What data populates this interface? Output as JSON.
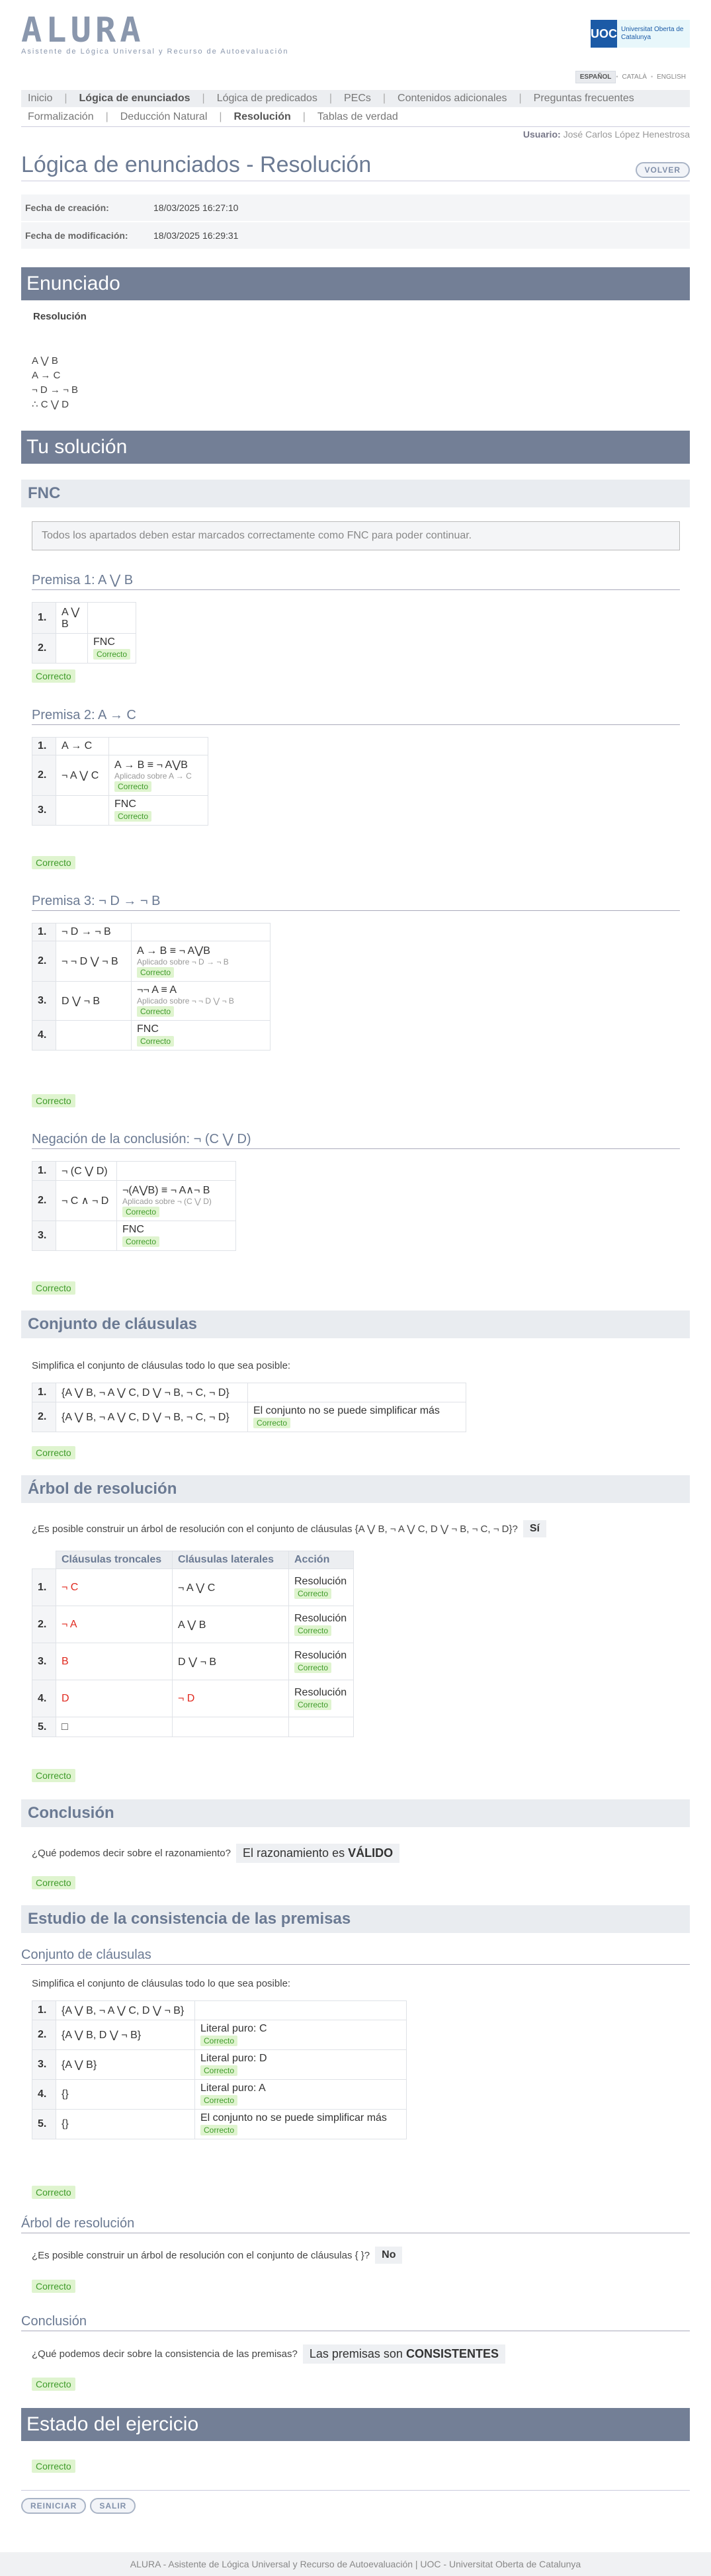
{
  "brand": {
    "logo": "ALURA",
    "subtitle": "Asistente de Lógica Universal y Recurso de Autoevaluación",
    "uoc_mark": "UOC",
    "uoc_name": "Universitat Oberta de Catalunya"
  },
  "langs": [
    "ESPAÑOL",
    "CATALÀ",
    "ENGLISH"
  ],
  "nav1": [
    "Inicio",
    "Lógica de enunciados",
    "Lógica de predicados",
    "PECs",
    "Contenidos adicionales",
    "Preguntas frecuentes"
  ],
  "nav2": [
    "Formalización",
    "Deducción Natural",
    "Resolución",
    "Tablas de verdad"
  ],
  "user": {
    "label": "Usuario:",
    "name": "José Carlos López Henestrosa"
  },
  "page_title": "Lógica de enunciados - Resolución",
  "back": "VOLVER",
  "dates": {
    "created_label": "Fecha de creación:",
    "created": "18/03/2025 16:27:10",
    "modified_label": "Fecha de modificación:",
    "modified": "18/03/2025 16:29:31"
  },
  "enunciado": {
    "title": "Enunciado",
    "sub": "Resolución",
    "lines": [
      "A ⋁ B",
      "A → C",
      "¬ D → ¬ B",
      "∴ C ⋁ D"
    ]
  },
  "solucion": {
    "title": "Tu solución",
    "fnc": "FNC",
    "info": "Todos los apartados deben estar marcados correctamente como FNC para poder continuar.",
    "ok": "Correcto"
  },
  "p1": {
    "title": "Premisa 1: A ⋁ B",
    "rows": [
      [
        "1.",
        "A ⋁ B",
        ""
      ],
      [
        "2.",
        "",
        "FNC"
      ]
    ]
  },
  "p2": {
    "title": "Premisa 2: A → C",
    "rows": [
      [
        "1.",
        "A → C",
        "",
        ""
      ],
      [
        "2.",
        "¬ A ⋁ C",
        "A → B ≡ ¬ A⋁B",
        "Aplicado sobre A → C"
      ],
      [
        "3.",
        "",
        "FNC",
        ""
      ]
    ]
  },
  "p3": {
    "title": "Premisa 3: ¬ D → ¬ B",
    "rows": [
      [
        "1.",
        "¬ D → ¬ B",
        "",
        ""
      ],
      [
        "2.",
        "¬ ¬ D ⋁ ¬ B",
        "A → B ≡ ¬ A⋁B",
        "Aplicado sobre ¬ D → ¬ B"
      ],
      [
        "3.",
        "D ⋁ ¬ B",
        "¬¬ A ≡ A",
        "Aplicado sobre ¬ ¬ D ⋁ ¬ B"
      ],
      [
        "4.",
        "",
        "FNC",
        ""
      ]
    ]
  },
  "neg": {
    "title": "Negación de la conclusión: ¬ (C ⋁ D)",
    "rows": [
      [
        "1.",
        "¬ (C ⋁ D)",
        "",
        ""
      ],
      [
        "2.",
        "¬ C ∧ ¬ D",
        "¬(A⋁B) ≡ ¬ A∧¬ B",
        "Aplicado sobre ¬ (C ⋁ D)"
      ],
      [
        "3.",
        "",
        "FNC",
        ""
      ]
    ]
  },
  "conjunto": {
    "title": "Conjunto de cláusulas",
    "prompt": "Simplifica el conjunto de cláusulas todo lo que sea posible:",
    "rows": [
      [
        "1.",
        "{A ⋁ B, ¬ A ⋁ C, D ⋁ ¬ B, ¬ C, ¬ D}",
        ""
      ],
      [
        "2.",
        "{A ⋁ B, ¬ A ⋁ C, D ⋁ ¬ B, ¬ C, ¬ D}",
        "El conjunto no se puede simplificar más"
      ]
    ]
  },
  "arbol": {
    "title": "Árbol de resolución",
    "question": "¿Es posible construir un árbol de resolución con el conjunto de cláusulas {A ⋁ B, ¬ A ⋁ C, D ⋁ ¬ B, ¬ C, ¬ D}?",
    "answer": "Sí",
    "headers": [
      "Cláusulas troncales",
      "Cláusulas laterales",
      "Acción"
    ],
    "rows": [
      [
        "1.",
        "¬ C",
        "¬ A ⋁ C",
        "Resolución"
      ],
      [
        "2.",
        "¬ A",
        "A ⋁ B",
        "Resolución"
      ],
      [
        "3.",
        "B",
        "D ⋁ ¬ B",
        "Resolución"
      ],
      [
        "4.",
        "D",
        "¬ D",
        "Resolución"
      ],
      [
        "5.",
        "□",
        "",
        ""
      ]
    ]
  },
  "conclusion": {
    "title": "Conclusión",
    "question": "¿Qué podemos decir sobre el razonamiento?",
    "answer_pre": "El razonamiento es ",
    "answer": "VÁLIDO"
  },
  "consist": {
    "title": "Estudio de la consistencia de las premisas",
    "conj_title": "Conjunto de cláusulas",
    "prompt": "Simplifica el conjunto de cláusulas todo lo que sea posible:",
    "rows": [
      [
        "1.",
        "{A ⋁ B, ¬ A ⋁ C, D ⋁ ¬ B}",
        ""
      ],
      [
        "2.",
        "{A ⋁ B, D ⋁ ¬ B}",
        "Literal puro: C"
      ],
      [
        "3.",
        "{A ⋁ B}",
        "Literal puro: D"
      ],
      [
        "4.",
        "{}",
        "Literal puro: A"
      ],
      [
        "5.",
        "{}",
        "El conjunto no se puede simplificar más"
      ]
    ],
    "arbol_title": "Árbol de resolución",
    "arbol_q": "¿Es posible construir un árbol de resolución con el conjunto de cláusulas { }?",
    "arbol_a": "No",
    "concl_title": "Conclusión",
    "concl_q": "¿Qué podemos decir sobre la consistencia de las premisas?",
    "concl_pre": "Las premisas son ",
    "concl_a": "CONSISTENTES"
  },
  "estado": {
    "title": "Estado del ejercicio"
  },
  "buttons": {
    "restart": "REINICIAR",
    "exit": "SALIR"
  },
  "footer": "ALURA - Asistente de Lógica Universal y Recurso de Autoevaluación | UOC - Universitat Oberta de Catalunya"
}
